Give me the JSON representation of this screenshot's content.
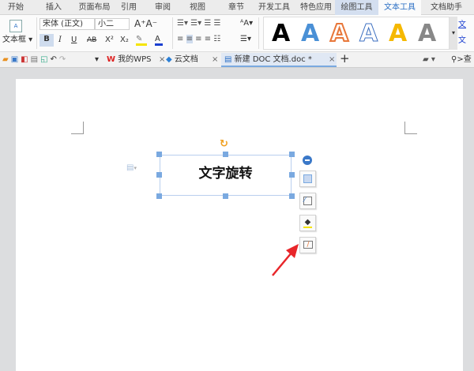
{
  "menu_tabs": [
    "开始",
    "插入",
    "页面布局",
    "引用",
    "审阅",
    "视图",
    "章节",
    "开发工具",
    "特色应用",
    "绘图工具",
    "文本工具",
    "文档助手"
  ],
  "ribbon": {
    "textbox_label": "文本框",
    "font_name": "宋体 (正文)",
    "font_size": "小二",
    "bold": "B",
    "italic": "I",
    "underline": "U",
    "strike": "AB",
    "superscript": "X²",
    "subscript": "X₂",
    "font_color": "A",
    "style_samples": [
      "A",
      "A",
      "A",
      "A",
      "A",
      "A"
    ],
    "right_labels": [
      "文",
      "文"
    ]
  },
  "doc_tabs": [
    {
      "label": "我的WPS",
      "icon": "wps-icon"
    },
    {
      "label": "云文档",
      "icon": "cloud-doc-icon"
    },
    {
      "label": "新建 DOC 文档.doc *",
      "icon": "doc-icon",
      "active": true
    }
  ],
  "search_label": ">查",
  "textbox": {
    "text": "文字旋转"
  },
  "colors": {
    "accent": "#2b6fc4",
    "handle": "#7aa9e0",
    "arrow": "#e8262a",
    "rotate": "#f0a020"
  }
}
